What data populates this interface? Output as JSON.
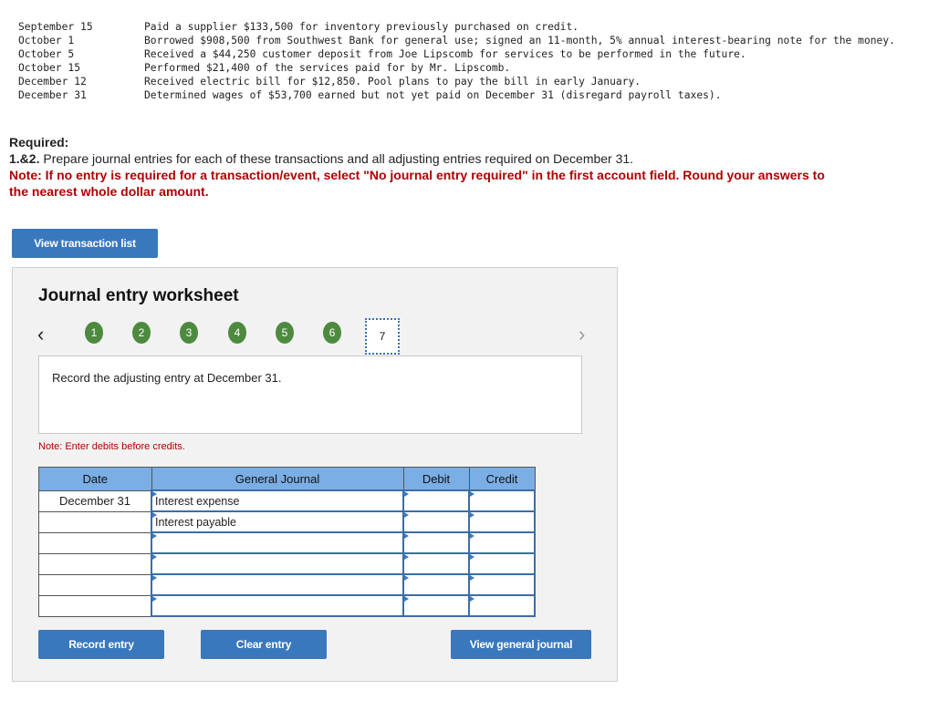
{
  "transactions": [
    {
      "date": "September 15",
      "desc": "Paid a supplier $133,500 for inventory previously purchased on credit."
    },
    {
      "date": "October 1",
      "desc": "Borrowed $908,500 from Southwest Bank for general use; signed an 11-month, 5% annual interest-bearing note for the money."
    },
    {
      "date": "October 5",
      "desc": "Received a $44,250 customer deposit from Joe Lipscomb for services to be performed in the future."
    },
    {
      "date": "October 15",
      "desc": "Performed $21,400 of the services paid for by Mr. Lipscomb."
    },
    {
      "date": "December 12",
      "desc": "Received electric bill for $12,850. Pool plans to pay the bill in early January."
    },
    {
      "date": "December 31",
      "desc": "Determined wages of $53,700 earned but not yet paid on December 31 (disregard payroll taxes)."
    }
  ],
  "required": {
    "heading": "Required:",
    "part_label": "1.&2.",
    "part_text": " Prepare journal entries for each of these transactions and all adjusting entries required on December 31.",
    "note": "Note: If no entry is required for a transaction/event, select \"No journal entry required\" in the first account field. Round your answers to the nearest whole dollar amount."
  },
  "buttons": {
    "view_transaction_list": "View transaction list",
    "record_entry": "Record entry",
    "clear_entry": "Clear entry",
    "view_general_journal": "View general journal"
  },
  "worksheet": {
    "title": "Journal entry worksheet",
    "prev_icon": "‹",
    "next_icon": "›",
    "steps": [
      "1",
      "2",
      "3",
      "4",
      "5",
      "6"
    ],
    "current_step": "7",
    "instruction": "Record the adjusting entry at December 31.",
    "debits_note": "Note: Enter debits before credits.",
    "columns": {
      "date": "Date",
      "journal": "General Journal",
      "debit": "Debit",
      "credit": "Credit"
    },
    "rows": [
      {
        "date": "December 31",
        "account": "Interest expense",
        "debit": "",
        "credit": ""
      },
      {
        "date": "",
        "account": "Interest payable",
        "debit": "",
        "credit": ""
      },
      {
        "date": "",
        "account": "",
        "debit": "",
        "credit": ""
      },
      {
        "date": "",
        "account": "",
        "debit": "",
        "credit": ""
      },
      {
        "date": "",
        "account": "",
        "debit": "",
        "credit": ""
      },
      {
        "date": "",
        "account": "",
        "debit": "",
        "credit": ""
      }
    ]
  }
}
